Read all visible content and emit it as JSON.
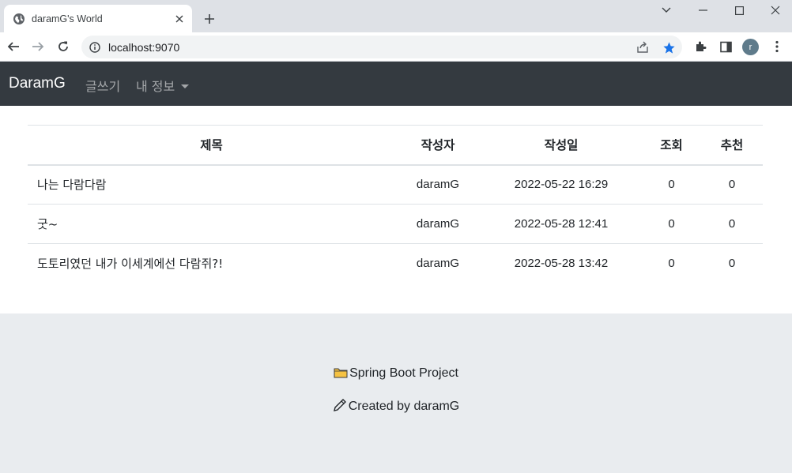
{
  "browser": {
    "tab_title": "daramG's World",
    "url": "localhost:9070",
    "profile_initial": "r"
  },
  "navbar": {
    "brand": "DaramG",
    "links": [
      "글쓰기",
      "내 정보"
    ]
  },
  "table": {
    "headers": [
      "제목",
      "작성자",
      "작성일",
      "조회",
      "추천"
    ],
    "rows": [
      {
        "title": "나는 다람다람",
        "writer": "daramG",
        "date": "2022-05-22 16:29",
        "views": "0",
        "likes": "0"
      },
      {
        "title": "굿~",
        "writer": "daramG",
        "date": "2022-05-28 12:41",
        "views": "0",
        "likes": "0"
      },
      {
        "title": "도토리였던 내가 이세계에선 다람쥐?!",
        "writer": "daramG",
        "date": "2022-05-28 13:42",
        "views": "0",
        "likes": "0"
      }
    ]
  },
  "footer": {
    "project": "Spring Boot Project",
    "credit": "Created by daramG"
  },
  "colors": {
    "navbar_bg": "#343a40",
    "footer_bg": "#e9ecef",
    "star": "#1a73e8"
  },
  "icons": {
    "tab": "globe-icon",
    "project": "folder-icon",
    "credit": "pencil-icon"
  }
}
